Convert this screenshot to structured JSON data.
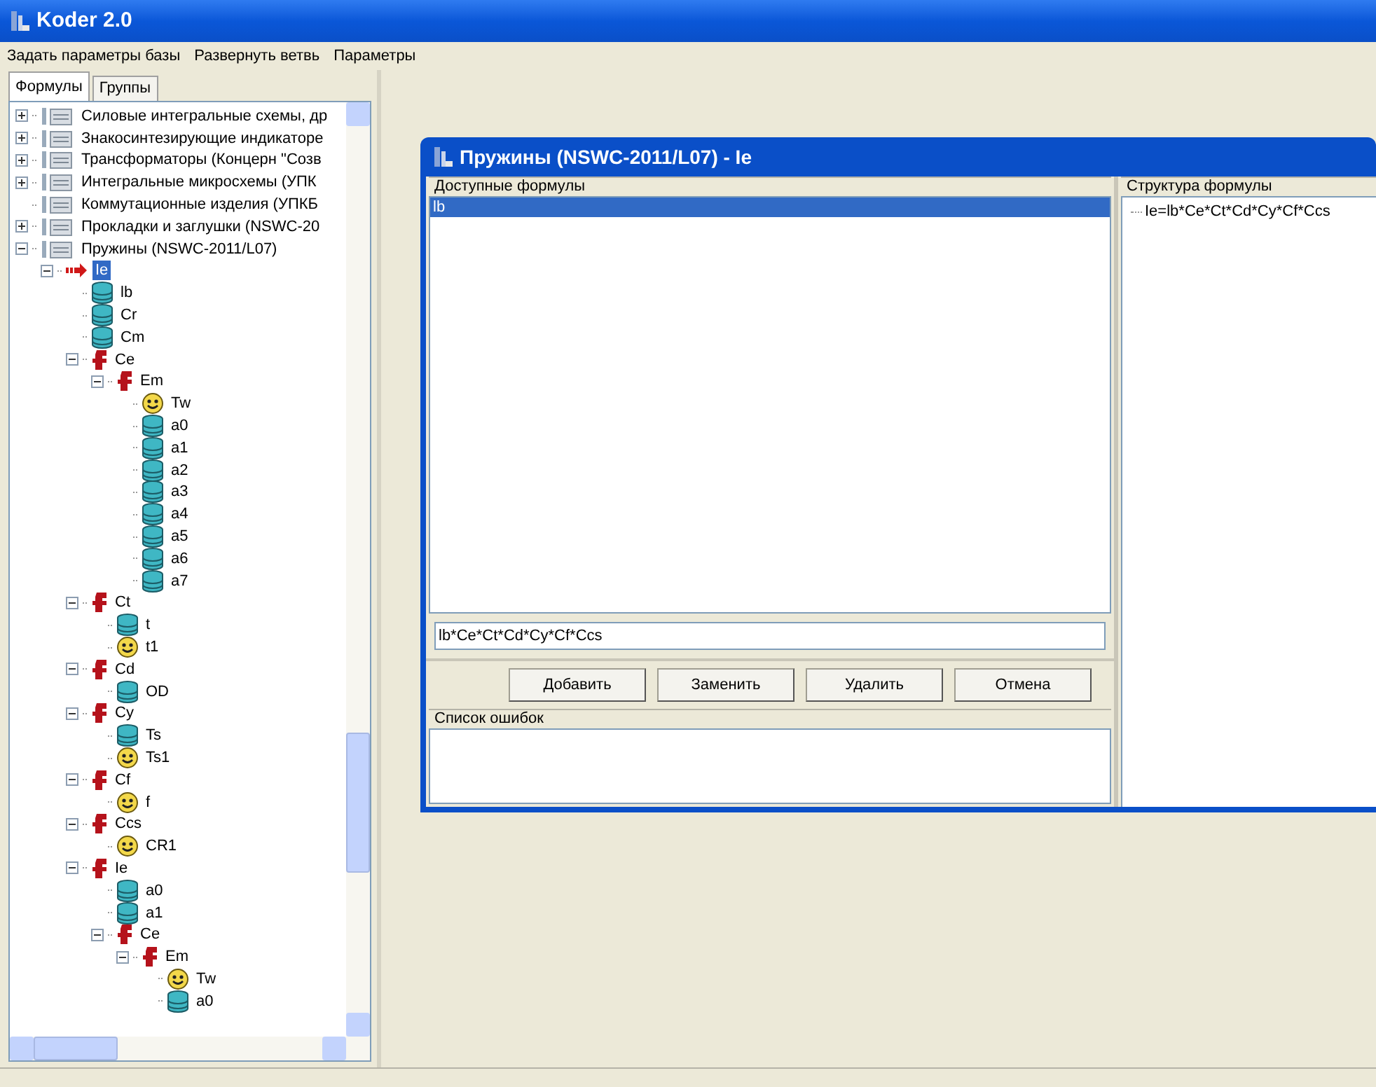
{
  "window": {
    "title": "Koder 2.0"
  },
  "menu": [
    "Задать параметры базы",
    "Развернуть ветвь",
    "Параметры"
  ],
  "tabs": [
    {
      "label": "Формулы",
      "selected": true
    },
    {
      "label": "Группы",
      "selected": false
    }
  ],
  "tree": [
    {
      "kind": "group",
      "label": "Силовые интегральные схемы, др",
      "expanded": false
    },
    {
      "kind": "group",
      "label": "Знакосинтезирующие индикаторе",
      "expanded": false
    },
    {
      "kind": "group",
      "label": "Трансформаторы (Концерн \"Созв",
      "expanded": false
    },
    {
      "kind": "group",
      "label": "Интегральные микросхемы (УПК",
      "expanded": false
    },
    {
      "kind": "group",
      "label": "Коммутационные изделия (УПКБ"
    },
    {
      "kind": "group",
      "label": "Прокладки и заглушки (NSWC-20",
      "expanded": false
    },
    {
      "kind": "group",
      "label": "Пружины (NSWC-2011/L07)",
      "expanded": true,
      "children": [
        {
          "kind": "current",
          "label": "Ie",
          "selected": true,
          "expanded": true,
          "children": [
            {
              "kind": "param",
              "label": "lb"
            },
            {
              "kind": "param",
              "label": "Cr"
            },
            {
              "kind": "param",
              "label": "Cm"
            },
            {
              "kind": "formula",
              "label": "Ce",
              "expanded": true,
              "children": [
                {
                  "kind": "formula",
                  "label": "Em",
                  "expanded": true,
                  "children": [
                    {
                      "kind": "constant",
                      "label": "Tw"
                    },
                    {
                      "kind": "param",
                      "label": "a0"
                    },
                    {
                      "kind": "param",
                      "label": "a1"
                    },
                    {
                      "kind": "param",
                      "label": "a2"
                    },
                    {
                      "kind": "param",
                      "label": "a3"
                    },
                    {
                      "kind": "param",
                      "label": "a4"
                    },
                    {
                      "kind": "param",
                      "label": "a5"
                    },
                    {
                      "kind": "param",
                      "label": "a6"
                    },
                    {
                      "kind": "param",
                      "label": "a7"
                    }
                  ]
                }
              ]
            },
            {
              "kind": "formula",
              "label": "Ct",
              "expanded": true,
              "children": [
                {
                  "kind": "param",
                  "label": "t"
                },
                {
                  "kind": "constant",
                  "label": "t1"
                }
              ]
            },
            {
              "kind": "formula",
              "label": "Cd",
              "expanded": true,
              "children": [
                {
                  "kind": "param",
                  "label": "OD"
                }
              ]
            },
            {
              "kind": "formula",
              "label": "Cy",
              "expanded": true,
              "children": [
                {
                  "kind": "param",
                  "label": "Ts"
                },
                {
                  "kind": "constant",
                  "label": "Ts1"
                }
              ]
            },
            {
              "kind": "formula",
              "label": "Cf",
              "expanded": true,
              "children": [
                {
                  "kind": "constant",
                  "label": "f"
                }
              ]
            },
            {
              "kind": "formula",
              "label": "Ccs",
              "expanded": true,
              "children": [
                {
                  "kind": "constant",
                  "label": "CR1"
                }
              ]
            },
            {
              "kind": "formula",
              "label": "Ie",
              "expanded": true,
              "children": [
                {
                  "kind": "param",
                  "label": "a0"
                },
                {
                  "kind": "param",
                  "label": "a1"
                },
                {
                  "kind": "formula",
                  "label": "Ce",
                  "expanded": true,
                  "children": [
                    {
                      "kind": "formula",
                      "label": "Em",
                      "expanded": true,
                      "children": [
                        {
                          "kind": "constant",
                          "label": "Tw"
                        },
                        {
                          "kind": "param",
                          "label": "a0"
                        }
                      ]
                    }
                  ]
                }
              ]
            }
          ]
        }
      ]
    }
  ],
  "dialog": {
    "title": "Пружины (NSWC-2011/L07) - Ie",
    "available": {
      "label": "Доступные формулы",
      "items": [
        {
          "label": "lb",
          "selected": true
        }
      ]
    },
    "formula_input": {
      "value": "lb*Ce*Ct*Cd*Cy*Cf*Ccs"
    },
    "buttons": [
      "Добавить",
      "Заменить",
      "Удалить",
      "Отмена"
    ],
    "errors": {
      "label": "Список ошибок"
    },
    "structure": {
      "label": "Структура формулы",
      "items": [
        {
          "label": "Ie=lb*Ce*Ct*Cd*Cy*Cf*Ccs"
        }
      ]
    }
  }
}
